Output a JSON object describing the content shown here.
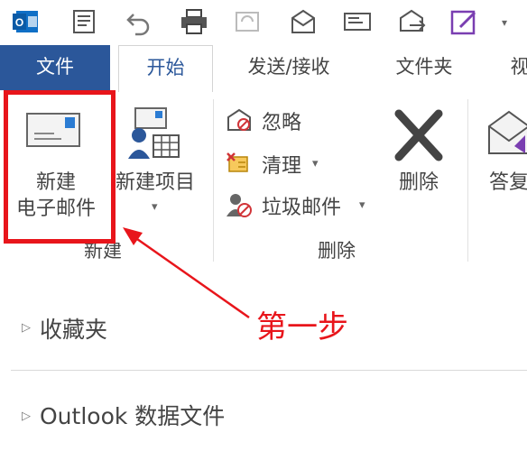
{
  "quick_access": {
    "icons": [
      "outlook-logo-icon",
      "new-items-icon",
      "undo-icon",
      "print-icon",
      "sync-icon",
      "reply-all-icon",
      "send-receive-icon",
      "mail-icon",
      "edit-icon"
    ]
  },
  "tabs": [
    {
      "label": "文件"
    },
    {
      "label": "开始"
    },
    {
      "label": "发送/接收"
    },
    {
      "label": "文件夹"
    },
    {
      "label": "视"
    }
  ],
  "ribbon": {
    "new_group": {
      "new_email_line1": "新建",
      "new_email_line2": "电子邮件",
      "new_items_label": "新建项目",
      "group_label": "新建"
    },
    "delete_group": {
      "ignore_label": "忽略",
      "cleanup_label": "清理",
      "junk_label": "垃圾邮件",
      "delete_label": "删除",
      "group_label": "删除"
    },
    "respond_group": {
      "reply_label": "答复"
    }
  },
  "nav": {
    "favorites": "收藏夹",
    "data_file": "Outlook 数据文件"
  },
  "annotation": {
    "text": "第一步"
  },
  "colors": {
    "file_tab": "#2b579a",
    "highlight": "#e8151b"
  }
}
